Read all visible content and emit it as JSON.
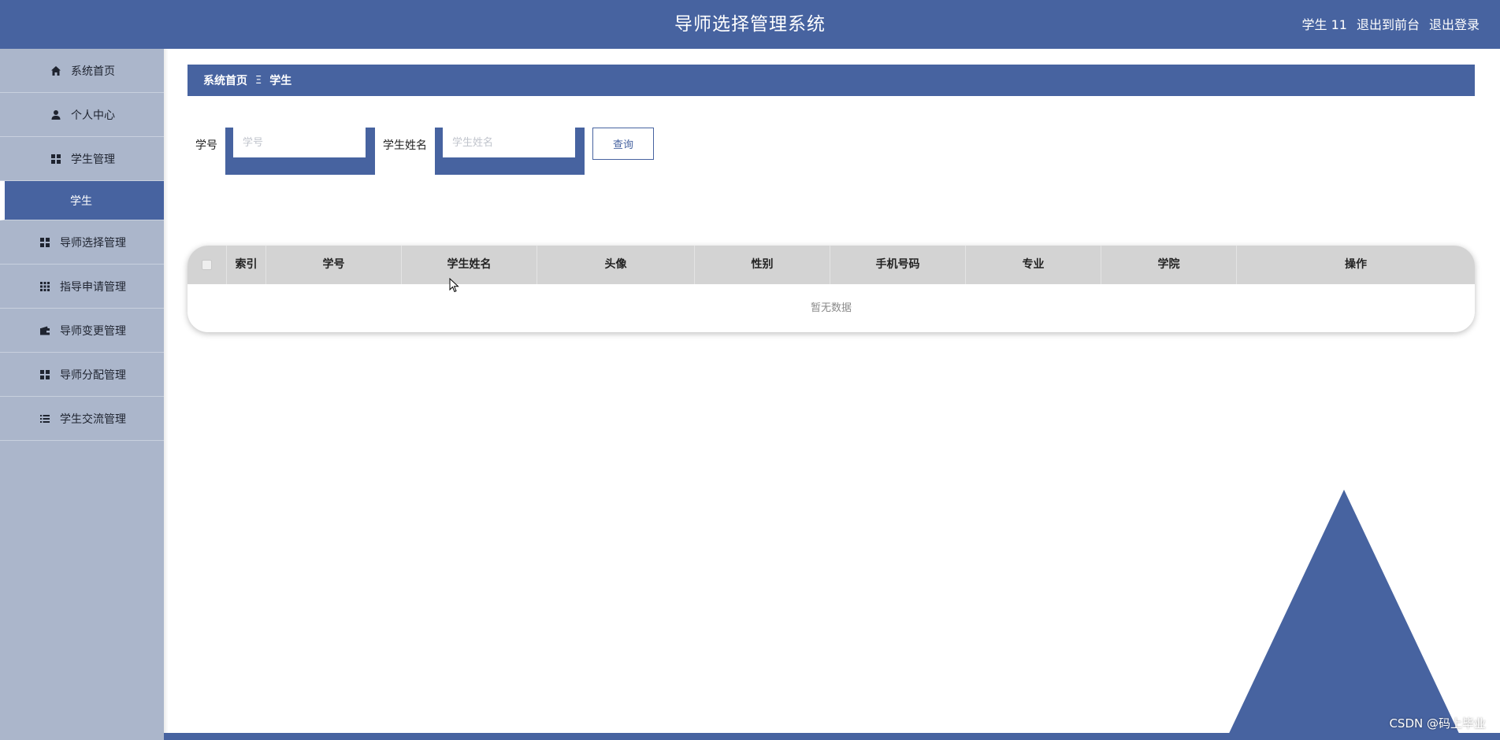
{
  "header": {
    "title": "导师选择管理系统",
    "user_label": "学生 11",
    "to_front_label": "退出到前台",
    "logout_label": "退出登录"
  },
  "sidebar": {
    "items": [
      {
        "label": "系统首页",
        "icon": "home-icon"
      },
      {
        "label": "个人中心",
        "icon": "user-icon"
      },
      {
        "label": "学生管理",
        "icon": "grid-icon"
      },
      {
        "label": "学生",
        "icon": ""
      },
      {
        "label": "导师选择管理",
        "icon": "grid-icon"
      },
      {
        "label": "指导申请管理",
        "icon": "apps-icon"
      },
      {
        "label": "导师变更管理",
        "icon": "wallet-icon"
      },
      {
        "label": "导师分配管理",
        "icon": "grid-icon"
      },
      {
        "label": "学生交流管理",
        "icon": "list-icon"
      }
    ]
  },
  "breadcrumb": {
    "home": "系统首页",
    "separator": "Ξ",
    "current": "学生"
  },
  "search": {
    "student_no_label": "学号",
    "student_no_placeholder": "学号",
    "student_name_label": "学生姓名",
    "student_name_placeholder": "学生姓名",
    "query_button": "查询"
  },
  "table": {
    "columns": [
      "",
      "索引",
      "学号",
      "学生姓名",
      "头像",
      "性别",
      "手机号码",
      "专业",
      "学院",
      "操作"
    ],
    "rows": [],
    "empty_text": "暂无数据"
  },
  "watermark": "CSDN @码上毕业",
  "colors": {
    "primary": "#4763a0",
    "sidebar_bg": "#abb6cb",
    "table_header_bg": "#d3d3d3"
  }
}
